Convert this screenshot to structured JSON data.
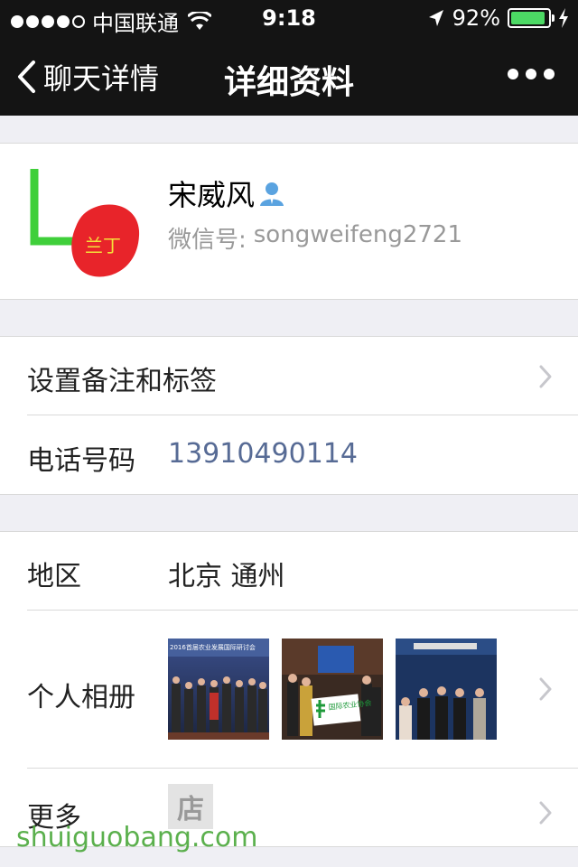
{
  "status_bar": {
    "carrier": "中国联通",
    "time": "9:18",
    "battery": "92%",
    "battery_level": 0.92
  },
  "nav": {
    "back_label": "聊天详情",
    "title": "详细资料"
  },
  "profile": {
    "avatar_text": "兰丁",
    "name": "宋威风",
    "wechat_id_label": "微信号:",
    "wechat_id": "songweifeng2721"
  },
  "rows": {
    "remark_label": "设置备注和标签",
    "phone_label": "电话号码",
    "phone_value": "13910490114",
    "region_label": "地区",
    "region_value": "北京 通州",
    "album_label": "个人相册",
    "more_label": "更多"
  },
  "album": {
    "photo1_banner": "2016首届农业发展国际研讨会",
    "photo2_sign": "国际农业协会"
  },
  "watermark": {
    "text": "shuiguobang.com",
    "store_char": "店"
  },
  "colors": {
    "bar": "#141414",
    "link": "#576b95",
    "battery": "#4cd964"
  },
  "icons": [
    "signal-dots-icon",
    "wifi-icon",
    "location-arrow-icon",
    "battery-icon",
    "charging-icon",
    "back-chevron-icon",
    "more-dots-icon",
    "person-icon",
    "chevron-right-icon"
  ]
}
